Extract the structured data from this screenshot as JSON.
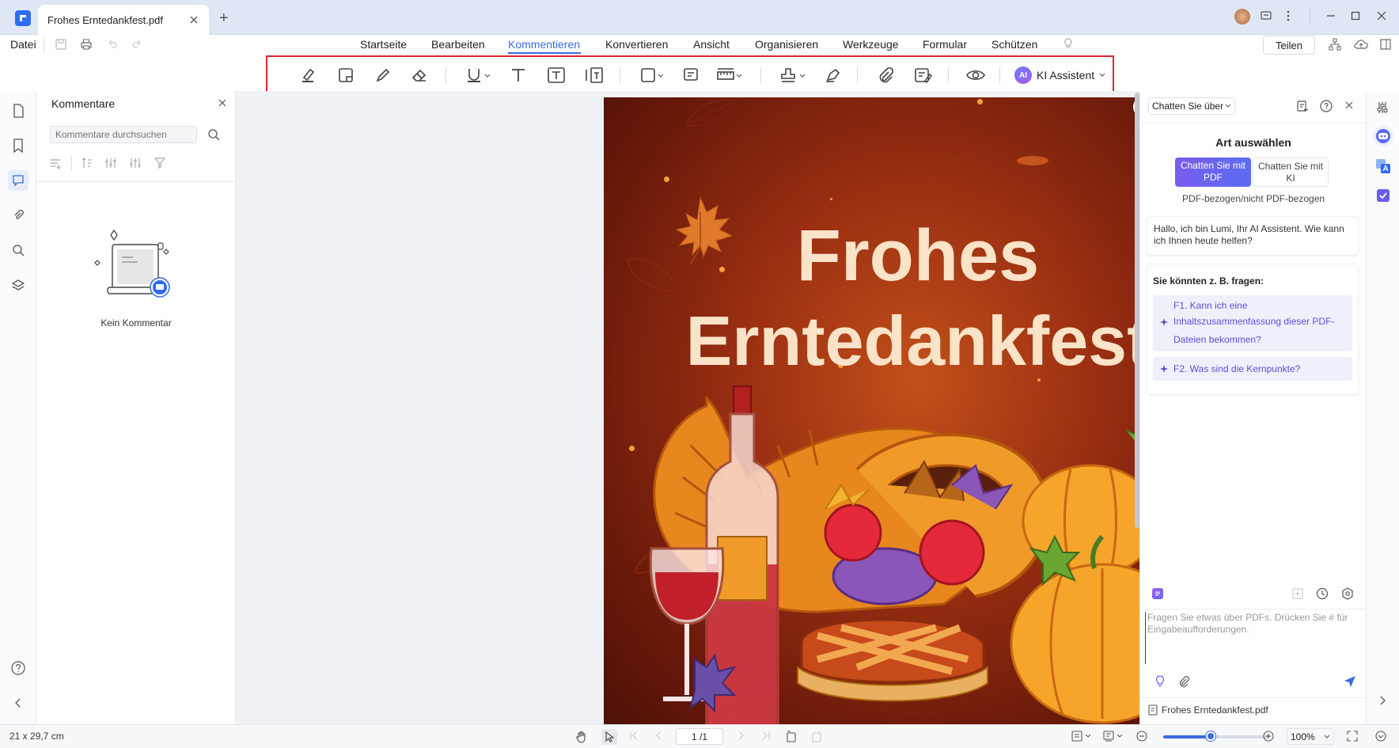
{
  "window": {
    "tab_title": "Frohes Erntedankfest.pdf",
    "new_tab": "+"
  },
  "menu": {
    "file": "Datei",
    "items": [
      "Startseite",
      "Bearbeiten",
      "Kommentieren",
      "Konvertieren",
      "Ansicht",
      "Organisieren",
      "Werkzeuge",
      "Formular",
      "Schützen"
    ],
    "active": "Kommentieren",
    "share": "Teilen"
  },
  "toolbar": {
    "tools": [
      "highlight-icon",
      "sticky-note-icon",
      "pencil-icon",
      "eraser-icon",
      "underline-icon",
      "text-icon",
      "textbox-icon",
      "callout-icon",
      "shape-icon",
      "note-icon",
      "measure-icon",
      "stamp-icon",
      "signature-icon",
      "attachment-icon",
      "summary-icon",
      "eye-icon"
    ],
    "ai_badge": "AI",
    "ai_label": "KI Assistent"
  },
  "comments": {
    "title": "Kommentare",
    "search_placeholder": "Kommentare durchsuchen",
    "empty": "Kein Kommentar"
  },
  "document": {
    "title_line1": "Frohes",
    "title_line2": "Erntedankfest"
  },
  "ai": {
    "mode_select": "Chatten Sie über P",
    "heading": "Art auswählen",
    "opt_pdf_line1": "Chatten Sie mit",
    "opt_pdf_line2": "PDF",
    "opt_ki_line1": "Chatten Sie mit",
    "opt_ki_line2": "KI",
    "subtitle": "PDF-bezogen/nicht PDF-bezogen",
    "greeting": "Hallo, ich bin Lumi, Ihr AI Assistent. Wie kann ich Ihnen heute helfen?",
    "suggest_title": "Sie könnten z. B. fragen:",
    "q1_l1": "F1. Kann ich eine",
    "q1_l2": "Inhaltszusammenfassung dieser PDF-",
    "q1_l3": "Dateien bekommen?",
    "q2": "F2. Was sind die Kernpunkte?",
    "input_placeholder_l1": "Fragen Sie etwas über PDFs. Drücken Sie # für",
    "input_placeholder_l2": "Eingabeaufforderungen.",
    "attached_file": "Frohes Erntedankfest.pdf"
  },
  "status": {
    "page_size": "21 x 29,7 cm",
    "page_indicator": "1 /1",
    "zoom": "100%",
    "zoom_slider_fraction": 0.45
  },
  "colors": {
    "accent": "#3b6be0",
    "highlight_frame": "#e0262e",
    "ai_purple": "#7b5cf0"
  }
}
